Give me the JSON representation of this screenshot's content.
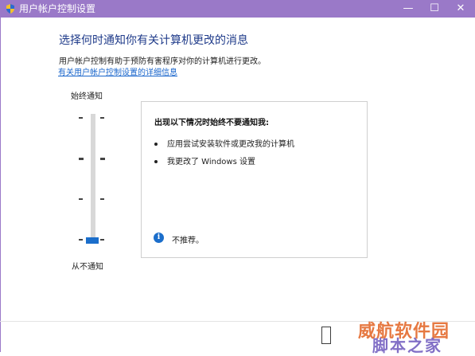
{
  "window": {
    "title": "用户帐户控制设置",
    "minimize_glyph": "—",
    "maximize_glyph": "☐",
    "close_glyph": "✕",
    "frame_color": "#9a79c8"
  },
  "main": {
    "heading": "选择何时通知你有关计算机更改的消息",
    "description": "用户帐户控制有助于预防有害程序对你的计算机进行更改。",
    "link": "有关用户帐户控制设置的详细信息"
  },
  "slider": {
    "top_label": "始终通知",
    "bottom_label": "从不通知",
    "levels": 4,
    "selected_level": 1,
    "accent": "#1b6ecb"
  },
  "panel": {
    "title": "出现以下情况时始终不要通知我:",
    "bullets": [
      "应用尝试安装软件或更改我的计算机",
      "我更改了 Windows 设置"
    ],
    "recommendation_icon": "info-icon",
    "recommendation": "不推荐。"
  },
  "watermark": {
    "line1": "威航软件园",
    "line2": "脚本之家"
  }
}
